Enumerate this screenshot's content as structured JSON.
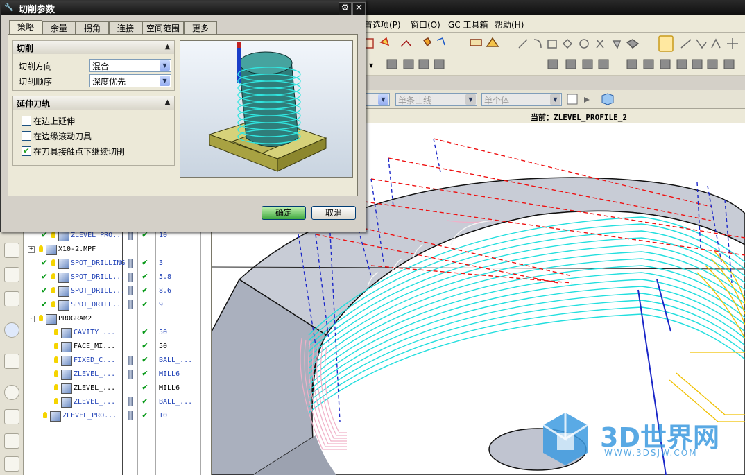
{
  "dialog": {
    "title": "切削参数",
    "tabs": [
      {
        "label": "策略"
      },
      {
        "label": "余量"
      },
      {
        "label": "拐角"
      },
      {
        "label": "连接"
      },
      {
        "label": "空间范围"
      },
      {
        "label": "更多"
      }
    ],
    "group_cut": {
      "header": "切削",
      "direction_label": "切削方向",
      "direction_value": "混合",
      "order_label": "切削顺序",
      "order_value": "深度优先"
    },
    "group_extend": {
      "header": "延伸刀轨",
      "options": [
        {
          "label": "在边上延伸",
          "checked": false
        },
        {
          "label": "在边缘滚动刀具",
          "checked": false
        },
        {
          "label": "在刀具接触点下继续切削",
          "checked": true
        }
      ]
    },
    "ok_label": "确定",
    "cancel_label": "取消"
  },
  "menubar": {
    "items": [
      {
        "label": "首选项(P)"
      },
      {
        "label": "窗口(O)"
      },
      {
        "label": "GC 工具箱"
      },
      {
        "label": "帮助(H)"
      }
    ]
  },
  "selection_bar": {
    "filter1": "",
    "filter2": "单条曲线",
    "filter3": "单个体"
  },
  "status": {
    "current": "当前：ZLEVEL_PROFILE_2"
  },
  "navigator": {
    "rows": [
      {
        "name": "ZLEVEL_PRO...",
        "col4": "10",
        "indent": 1,
        "check": true,
        "tool": true,
        "col3check": true
      },
      {
        "name": "X10-2.MPF",
        "col4": "",
        "indent": 0,
        "check": false,
        "tool": false,
        "col3check": false,
        "expander": "+"
      },
      {
        "name": "SPOT_DRILLING",
        "col4": "3",
        "indent": 1,
        "check": true,
        "tool": true,
        "col3check": true
      },
      {
        "name": "SPOT_DRILL...",
        "col4": "5.8",
        "indent": 1,
        "check": true,
        "tool": true,
        "col3check": true
      },
      {
        "name": "SPOT_DRILL...",
        "col4": "8.6",
        "indent": 1,
        "check": true,
        "tool": true,
        "col3check": true
      },
      {
        "name": "SPOT_DRILL...",
        "col4": "9",
        "indent": 1,
        "check": true,
        "tool": true,
        "col3check": true
      },
      {
        "name": "PROGRAM2",
        "col4": "",
        "indent": 0,
        "check": false,
        "tool": false,
        "col3check": false,
        "expander": "-"
      },
      {
        "name": "CAVITY_...",
        "col4": "50",
        "indent": 2,
        "check": false,
        "tool": false,
        "col3check": true
      },
      {
        "name": "FACE_MI...",
        "col4": "50",
        "indent": 2,
        "check": false,
        "tool": false,
        "col3check": true
      },
      {
        "name": "FIXED_C...",
        "col4": "BALL_...",
        "indent": 2,
        "check": false,
        "tool": true,
        "col3check": true
      },
      {
        "name": "ZLEVEL_...",
        "col4": "MILL6",
        "indent": 2,
        "check": false,
        "tool": true,
        "col3check": true
      },
      {
        "name": "ZLEVEL_...",
        "col4": "MILL6",
        "indent": 2,
        "check": false,
        "tool": false,
        "col3check": true
      },
      {
        "name": "ZLEVEL_...",
        "col4": "BALL_...",
        "indent": 2,
        "check": false,
        "tool": true,
        "col3check": true
      },
      {
        "name": "ZLEVEL_PRO...",
        "col4": "10",
        "indent": 1,
        "check": false,
        "tool": true,
        "col3check": true
      }
    ]
  },
  "watermark": {
    "text": "3D世界网",
    "url": "WWW.3DSJW.COM"
  },
  "colors": {
    "toolpath_cyan": "#22dede",
    "rapid_red": "#ee1111",
    "feed_blue": "#1b27c8",
    "toolpath_pink": "#f0b0c8",
    "toolpath_yellow": "#f0c000",
    "part_gray": "#b7bcc8"
  }
}
